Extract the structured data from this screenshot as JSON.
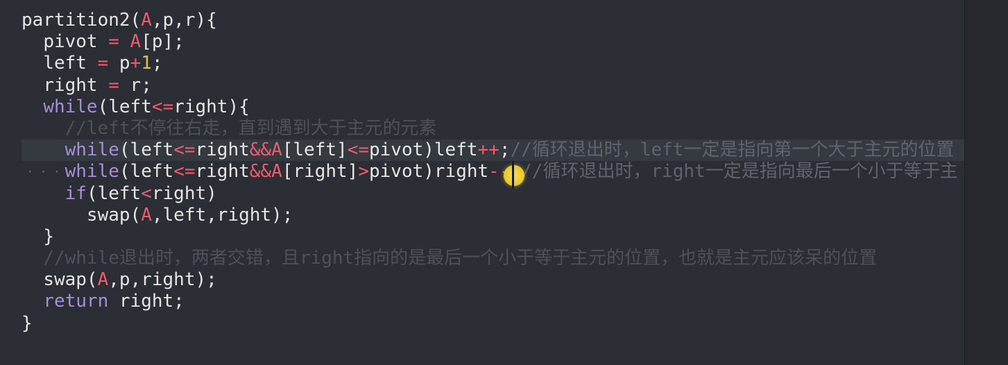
{
  "editor": {
    "lines": [
      {
        "indent": "",
        "tokens": [
          [
            "pl",
            "partition2("
          ],
          [
            "arr",
            "A"
          ],
          [
            "pl",
            ",p,r){"
          ]
        ]
      },
      {
        "indent": "  ",
        "tokens": [
          [
            "pl",
            "pivot "
          ],
          [
            "op",
            "="
          ],
          [
            "pl",
            " "
          ],
          [
            "arr",
            "A"
          ],
          [
            "pl",
            "[p];"
          ]
        ]
      },
      {
        "indent": "  ",
        "tokens": [
          [
            "pl",
            "left "
          ],
          [
            "op",
            "="
          ],
          [
            "pl",
            " p"
          ],
          [
            "op",
            "+"
          ],
          [
            "num",
            "1"
          ],
          [
            "pl",
            ";"
          ]
        ]
      },
      {
        "indent": "  ",
        "tokens": [
          [
            "pl",
            "right "
          ],
          [
            "op",
            "="
          ],
          [
            "pl",
            " r;"
          ]
        ]
      },
      {
        "indent": "  ",
        "tokens": [
          [
            "kw",
            "while"
          ],
          [
            "pl",
            "(left"
          ],
          [
            "op",
            "<="
          ],
          [
            "pl",
            "right){"
          ]
        ]
      },
      {
        "indent": "    ",
        "tokens": [
          [
            "cm-dim",
            "//left不停往右走，直到遇到大于主元的元素"
          ]
        ]
      },
      {
        "indent": "    ",
        "highlight": true,
        "tokens": [
          [
            "kw",
            "while"
          ],
          [
            "pl",
            "(left"
          ],
          [
            "op",
            "<="
          ],
          [
            "pl",
            "right"
          ],
          [
            "op",
            "&&"
          ],
          [
            "arr",
            "A"
          ],
          [
            "pl",
            "[left]"
          ],
          [
            "op",
            "<="
          ],
          [
            "pl",
            "pivot)left"
          ],
          [
            "op",
            "++"
          ],
          [
            "pl",
            ";"
          ],
          [
            "cm",
            "//循环退出时，left一定是指向第一个大于主元的位置"
          ]
        ]
      },
      {
        "indent": "    ",
        "dots": true,
        "tokens": [
          [
            "kw",
            "while"
          ],
          [
            "pl",
            "(left"
          ],
          [
            "op",
            "<="
          ],
          [
            "pl",
            "right"
          ],
          [
            "op",
            "&&"
          ],
          [
            "arr",
            "A"
          ],
          [
            "pl",
            "[right]"
          ],
          [
            "op",
            ">"
          ],
          [
            "pl",
            "pivot)right"
          ],
          [
            "op",
            "--"
          ],
          [
            "pl",
            ";"
          ],
          [
            "cm",
            "//循环退出时，right一定是指向最后一个小于等于主"
          ]
        ]
      },
      {
        "indent": "    ",
        "tokens": [
          [
            "kw",
            "if"
          ],
          [
            "pl",
            "(left"
          ],
          [
            "op",
            "<"
          ],
          [
            "pl",
            "right)"
          ]
        ]
      },
      {
        "indent": "      ",
        "tokens": [
          [
            "pl",
            "swap("
          ],
          [
            "arr",
            "A"
          ],
          [
            "pl",
            ",left,right);"
          ]
        ]
      },
      {
        "indent": "  ",
        "tokens": [
          [
            "pl",
            "}"
          ]
        ]
      },
      {
        "indent": "  ",
        "tokens": [
          [
            "cm-dim",
            "//while退出时，两者交错，且right指向的是最后一个小于等于主元的位置，也就是主元应该呆的位置"
          ]
        ]
      },
      {
        "indent": "  ",
        "tokens": [
          [
            "pl",
            "swap("
          ],
          [
            "arr",
            "A"
          ],
          [
            "pl",
            ",p,right);"
          ]
        ]
      },
      {
        "indent": "  ",
        "tokens": [
          [
            "kw",
            "return"
          ],
          [
            "pl",
            " right;"
          ]
        ]
      },
      {
        "indent": "",
        "tokens": [
          [
            "pl",
            "}"
          ]
        ]
      }
    ],
    "dots_text": "· · · · · ·"
  },
  "colors": {
    "background": "#2b2e34",
    "keyword": "#a58fd8",
    "operator": "#f05a6e",
    "number": "#d7c15e",
    "comment": "#5f636b",
    "cursor": "#f4e04d"
  }
}
